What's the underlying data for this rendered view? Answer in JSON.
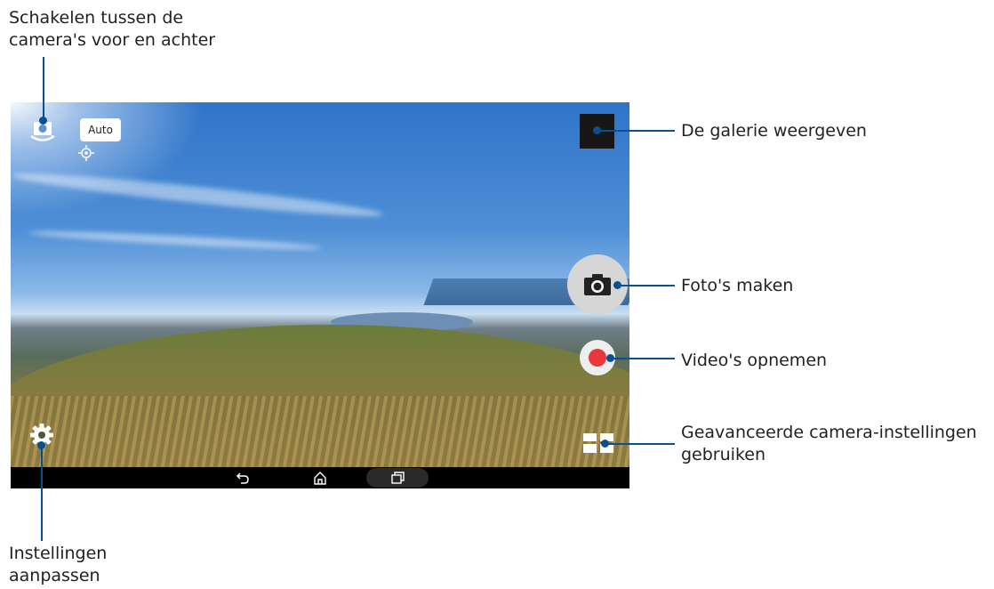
{
  "callouts": {
    "switch_camera": [
      "Schakelen tussen de",
      "camera's voor en achter"
    ],
    "gallery": "De galerie weergeven",
    "take_photo": "Foto's maken",
    "record_video": "Video's opnemen",
    "advanced_settings": [
      "Geavanceerde camera-instellingen",
      "gebruiken"
    ],
    "settings": [
      "Instellingen",
      "aanpassen"
    ]
  },
  "camera": {
    "mode_badge": "Auto"
  },
  "icons": {
    "switch_camera": "camera-switch-icon",
    "focus": "focus-target-icon",
    "shutter": "camera-icon",
    "record": "record-icon",
    "modes": "grid-modes-icon",
    "settings": "gear-icon",
    "nav_back": "back-icon",
    "nav_home": "home-icon",
    "nav_recent": "recent-apps-icon"
  },
  "colors": {
    "callout_line": "#0a4f8f",
    "record_red": "#e8373a",
    "navbar": "#000000"
  }
}
